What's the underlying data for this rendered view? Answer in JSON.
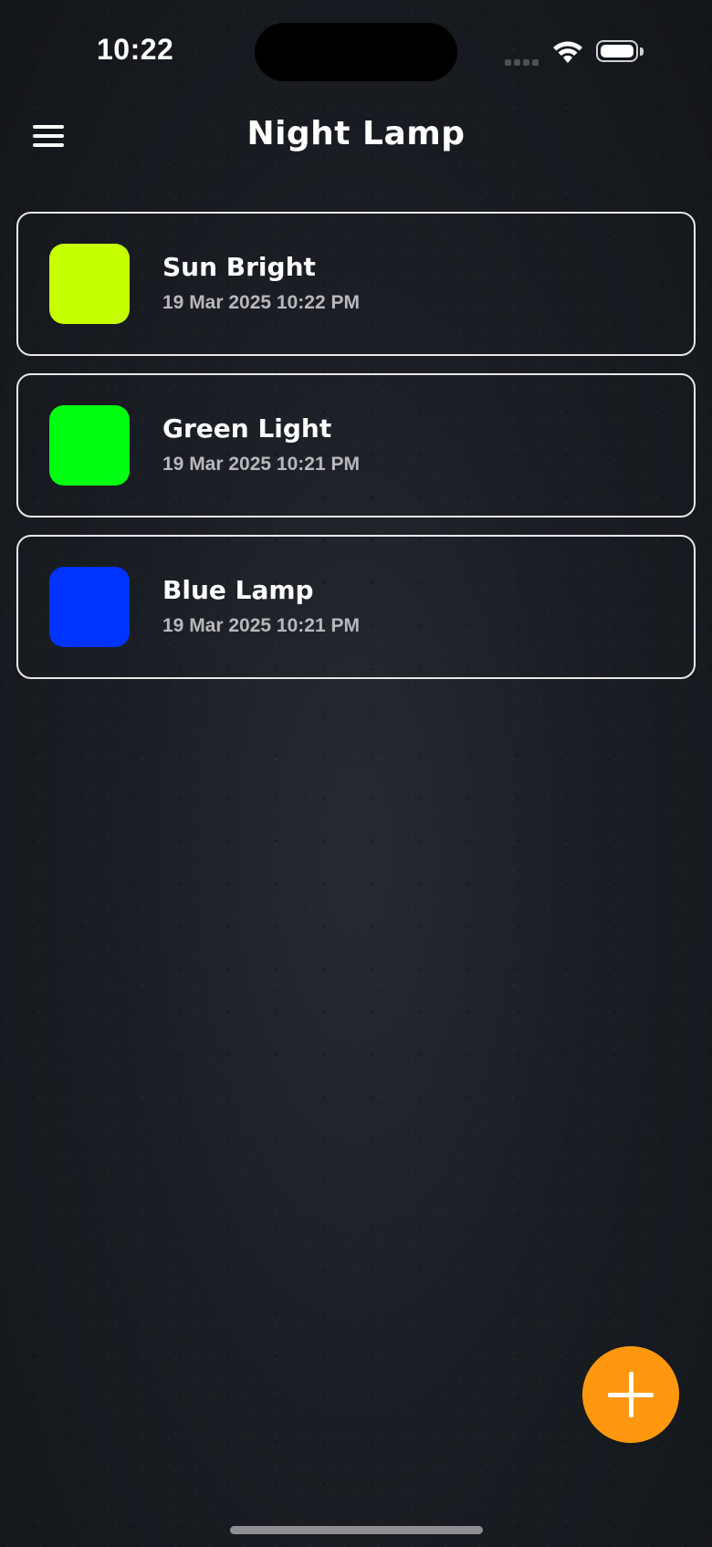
{
  "status_bar": {
    "time": "10:22",
    "icons": [
      "signal-icon",
      "wifi-icon",
      "battery-icon"
    ]
  },
  "header": {
    "title": "Night Lamp",
    "menu_icon": "hamburger-menu-icon"
  },
  "lamps": [
    {
      "name": "Sun Bright",
      "date": "19 Mar 2025 10:22 PM",
      "color": "#c6ff00"
    },
    {
      "name": "Green Light",
      "date": "19 Mar 2025 10:21 PM",
      "color": "#00ff11"
    },
    {
      "name": "Blue Lamp",
      "date": "19 Mar 2025 10:21 PM",
      "color": "#0033ff"
    }
  ],
  "fab": {
    "icon": "plus-icon",
    "color": "#ff980f"
  },
  "colors": {
    "card_border": "#e8e8e8",
    "date_text": "#b7b9bc",
    "background": "#1b1f25"
  }
}
